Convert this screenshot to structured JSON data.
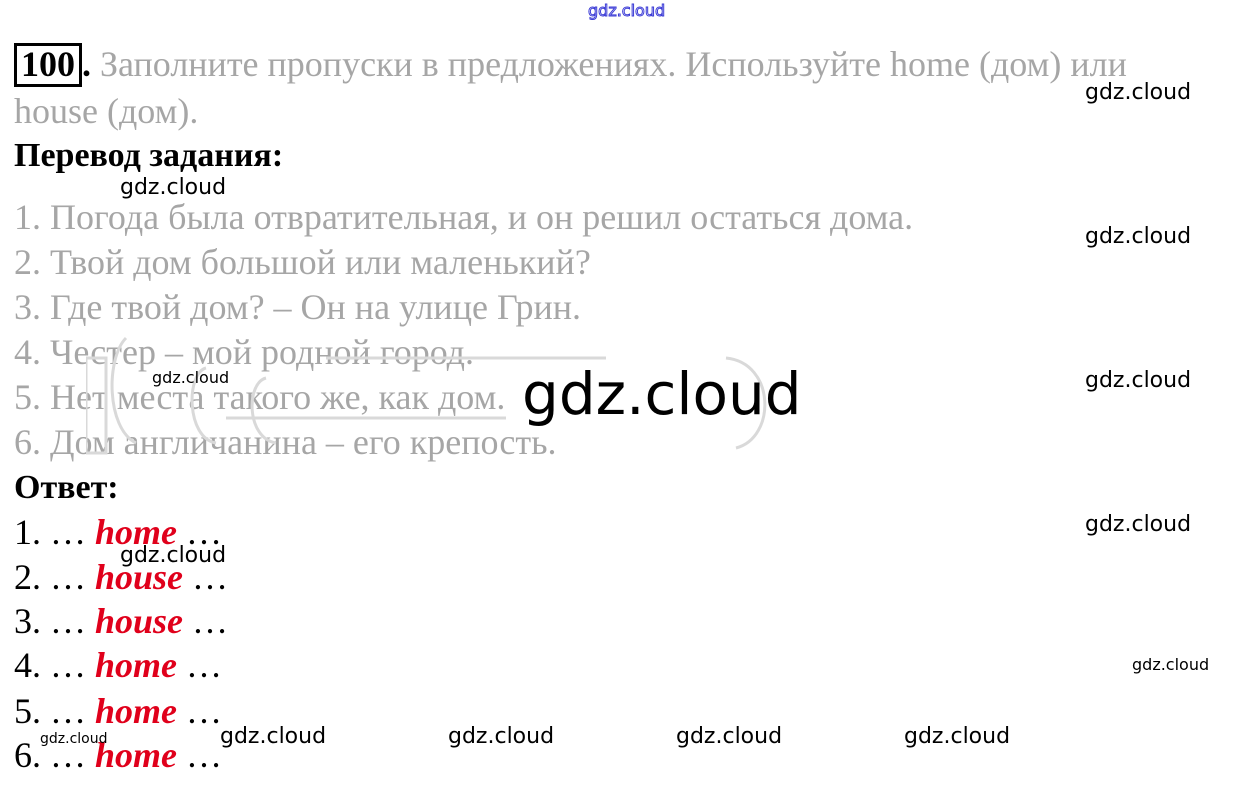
{
  "task": {
    "number": "100",
    "dot": ".",
    "text_line1": "Заполните пропуски в предложениях. Используйте home (дом) или",
    "text_line2": "house (дом)."
  },
  "translation": {
    "heading": "Перевод задания:",
    "sentences": [
      "1. Погода была отвратительная, и он решил остаться дома.",
      "2. Твой дом большой или маленький?",
      "3. Где твой дом? – Он на улице Грин.",
      "4. Честер – мой родной город.",
      "5. Нет места такого же, как дом.",
      "6. Дом англичанина – его крепость."
    ]
  },
  "answer": {
    "heading": "Ответ:",
    "items": [
      {
        "prefix": "1. … ",
        "word": "home",
        "suffix": " …"
      },
      {
        "prefix": "2. … ",
        "word": "house",
        "suffix": " …"
      },
      {
        "prefix": "3. … ",
        "word": "house",
        "suffix": " …"
      },
      {
        "prefix": "4. … ",
        "word": "home",
        "suffix": " …"
      },
      {
        "prefix": "5. … ",
        "word": "home",
        "suffix": " …"
      },
      {
        "prefix": "6. … ",
        "word": "home",
        "suffix": " …"
      }
    ]
  },
  "watermark": {
    "text": "gdz.cloud"
  },
  "colors": {
    "task_text": "#a6a6a6",
    "answer_word": "#e0001b",
    "top_watermark_outline": "#3b3bd6"
  }
}
